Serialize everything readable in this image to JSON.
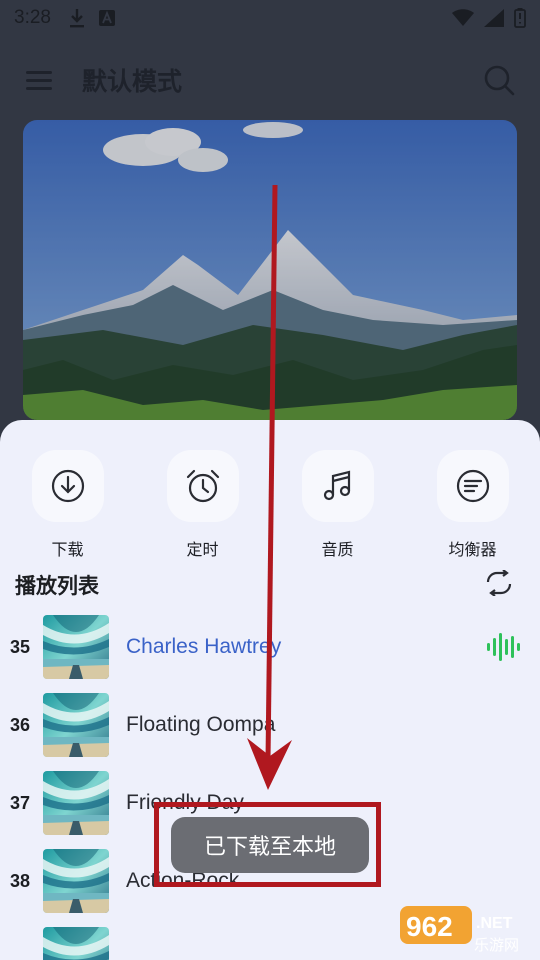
{
  "status_bar": {
    "time": "3:28",
    "icons": [
      "download-icon",
      "a-icon",
      "wifi-icon",
      "cellular-icon",
      "battery-icon"
    ]
  },
  "header": {
    "title": "默认模式",
    "menu_icon": "menu-icon",
    "search_icon": "search-icon"
  },
  "actions": [
    {
      "label": "下载",
      "icon": "download-icon"
    },
    {
      "label": "定时",
      "icon": "alarm-clock-icon"
    },
    {
      "label": "音质",
      "icon": "music-note-icon"
    },
    {
      "label": "均衡器",
      "icon": "equalizer-list-icon"
    }
  ],
  "playlist": {
    "title": "播放列表",
    "repeat_icon": "repeat-icon",
    "tracks": [
      {
        "number": "35",
        "title": "Charles Hawtrey",
        "active": true
      },
      {
        "number": "36",
        "title": "Floating Oompa",
        "active": false
      },
      {
        "number": "37",
        "title": "Friendly Day",
        "active": false
      },
      {
        "number": "38",
        "title": "Action-Rock",
        "active": false
      }
    ]
  },
  "toast": {
    "text": "已下载至本地"
  },
  "watermark": {
    "number": "962",
    "suffix": ".NET",
    "subtitle": "乐游网"
  },
  "colors": {
    "accent": "#3a62c8",
    "playing_indicator": "#2ec15a",
    "annotation": "#b0181f",
    "sheet_background": "#eef0fb"
  }
}
